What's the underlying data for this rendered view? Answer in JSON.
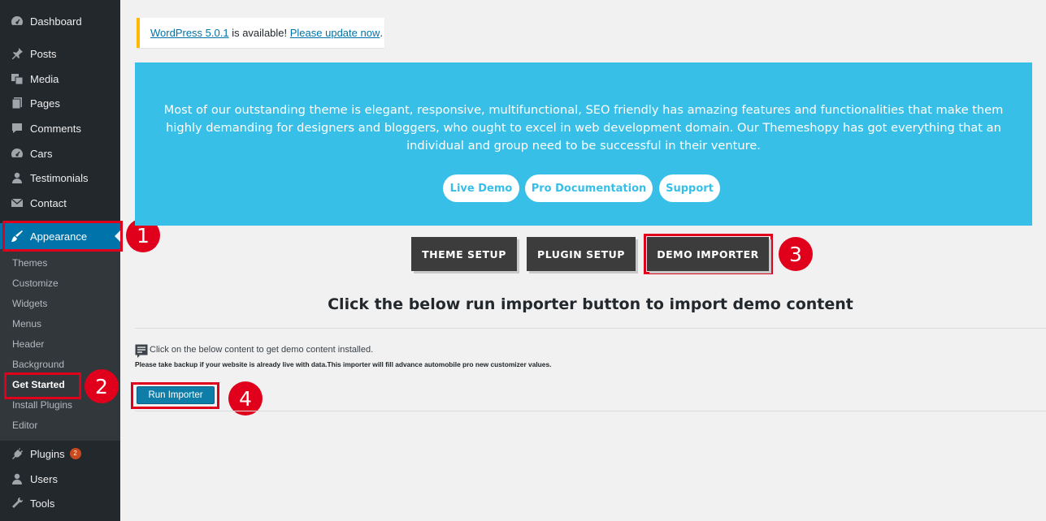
{
  "sidebar": {
    "items": [
      {
        "label": "Dashboard",
        "icon": "dashboard-icon"
      },
      {
        "label": "Posts",
        "icon": "pin-icon"
      },
      {
        "label": "Media",
        "icon": "media-icon"
      },
      {
        "label": "Pages",
        "icon": "pages-icon"
      },
      {
        "label": "Comments",
        "icon": "comment-icon"
      },
      {
        "label": "Cars",
        "icon": "dashboard-icon"
      },
      {
        "label": "Testimonials",
        "icon": "user-icon"
      },
      {
        "label": "Contact",
        "icon": "mail-icon"
      }
    ],
    "appearance": {
      "label": "Appearance",
      "icon": "brush-icon"
    },
    "submenu": [
      "Themes",
      "Customize",
      "Widgets",
      "Menus",
      "Header",
      "Background",
      "Get Started",
      "Install Plugins",
      "Editor"
    ],
    "plugins": {
      "label": "Plugins",
      "badge": "2",
      "icon": "plug-icon"
    },
    "users": {
      "label": "Users",
      "icon": "user-icon"
    },
    "tools": {
      "label": "Tools",
      "icon": "wrench-icon"
    }
  },
  "annotations": [
    "1",
    "2",
    "3",
    "4"
  ],
  "notice": {
    "version_link": "WordPress 5.0.1",
    "middle": " is available! ",
    "update_link": "Please update now",
    "end": "."
  },
  "banner": {
    "text": "Most of our outstanding theme is elegant, responsive, multifunctional, SEO friendly has amazing features and functionalities that make them highly demanding for designers and bloggers, who ought to excel in web development domain. Our Themeshopy has got everything that an individual and group need to be successful in their venture.",
    "buttons": [
      "Live Demo",
      "Pro Documentation",
      "Support"
    ]
  },
  "tabs": [
    "THEME SETUP",
    "PLUGIN SETUP",
    "DEMO IMPORTER"
  ],
  "heading": "Click the below run importer button to import demo content",
  "info_line": "Click on the below content to get demo content installed.",
  "warning_line": "Please take backup if your website is already live with data.This importer will fill advance automobile pro new customizer values.",
  "run_button": "Run Importer",
  "colors": {
    "sidebar_bg": "#23282d",
    "accent": "#0073aa",
    "banner": "#37bfe8",
    "tab_bg": "#3c3c3c",
    "annotation_red": "#e0001b"
  }
}
